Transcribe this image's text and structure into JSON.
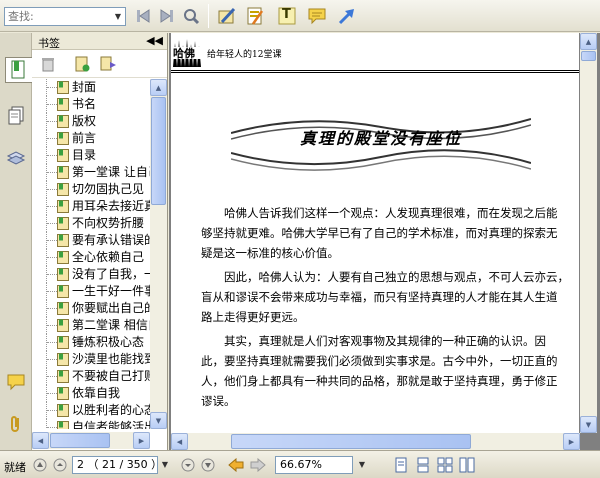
{
  "toolbar": {
    "find_placeholder": "查找:",
    "buttons": [
      {
        "name": "prev-result-icon"
      },
      {
        "name": "next-result-icon"
      },
      {
        "name": "search-icon"
      },
      {
        "name": "edit-text-icon"
      },
      {
        "name": "highlight-icon"
      },
      {
        "name": "text-tool-icon",
        "label": "T"
      },
      {
        "name": "comment-icon"
      },
      {
        "name": "arrow-icon"
      }
    ]
  },
  "sidebar": {
    "title": "书签",
    "collapse_glyph": "◀◀",
    "bookmarks": [
      "封面",
      "书名",
      "版权",
      "前言",
      "目录",
      "第一堂课 让自己成为主宰",
      "切勿固执己见",
      "用耳朵去接近真理",
      "不向权势折腰",
      "要有承认错误的勇气",
      "全心依赖自己",
      "没有了自我，一切皆空",
      "一生干好一件事",
      "你要赋出自己的",
      "第二堂课 相信自己",
      "锤炼积极心态",
      "沙漠里也能找到",
      "不要被自己打败",
      "依靠自我",
      "以胜利者的心态",
      "自信者能够活出"
    ]
  },
  "page": {
    "header_logo": "哈佛",
    "header_subtitle": "给年轻人的12堂课",
    "chapter_title": "真理的殿堂没有座位",
    "paragraphs": [
      [
        "哈佛人告诉我们这样一个观点：人发现真理很难，而在发现之后能",
        "够坚持就更难。哈佛大学早已有了自己的学术标准，而对真理的探索无",
        "疑是这一标准的核心价值。"
      ],
      [
        "因此，哈佛人认为：人要有自己独立的思想与观点，不可人云亦云，",
        "盲从和谬误不会带来成功与幸福，而只有坚持真理的人才能在其人生道",
        "路上走得更好更远。"
      ],
      [
        "其实，真理就是人们对客观事物及其规律的一种正确的认识。因",
        "此，要坚持真理就需要我们必须做到实事求是。古今中外，一切正直的",
        "人，他们身上都具有一种共同的品格，那就是敢于坚持真理，勇于修正",
        "谬误。"
      ]
    ]
  },
  "status": {
    "state": "就绪",
    "page_indicator": "2 （ 21 / 350 ）",
    "zoom": "66.67%"
  },
  "colors": {
    "bookmark_icon_fill": "#f5e6a8",
    "bookmark_icon_stroke": "#8a7a3a",
    "accent_blue": "#3c78d8"
  }
}
